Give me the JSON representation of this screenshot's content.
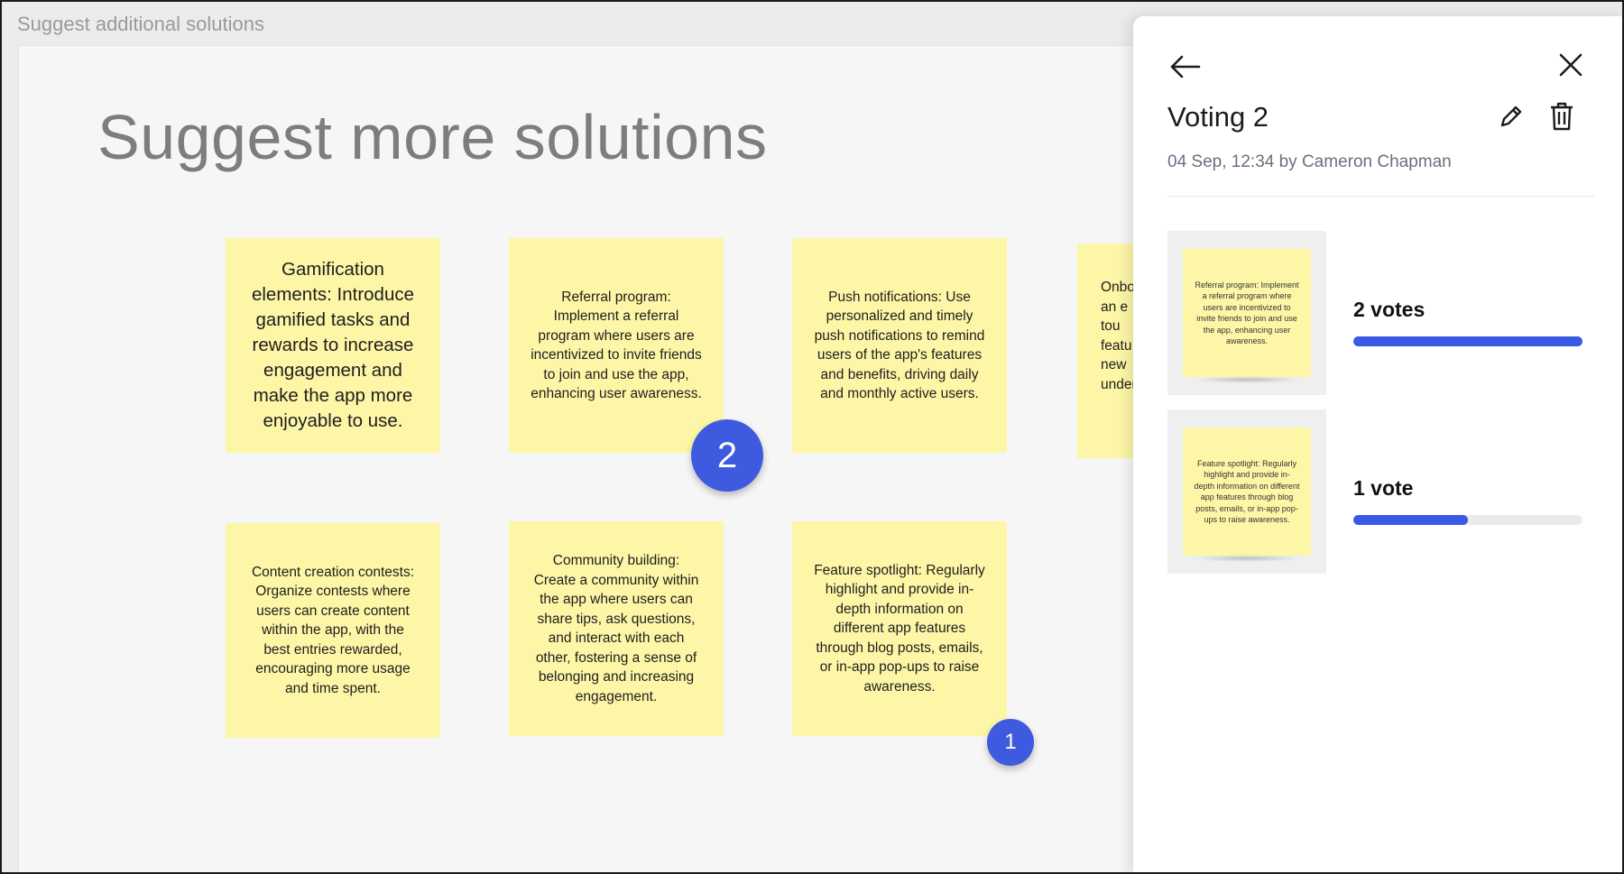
{
  "frame": {
    "title": "Suggest additional solutions"
  },
  "board": {
    "heading": "Suggest more solutions",
    "notes": [
      "Gamification elements: Introduce gamified tasks and rewards to increase engagement and make the app more enjoyable to use.",
      "Referral program: Implement a referral program where users are incentivized to invite friends to join and use the app, enhancing user awareness.",
      "Push notifications: Use personalized and timely push notifications to remind users of the app's features and benefits, driving daily and monthly active users.",
      "Onbo\nan e\ntou\nfeatu\nnew\nunder",
      "Content creation contests: Organize contests where users can create content within the app, with the best entries rewarded, encouraging more usage and time spent.",
      "Community building: Create a community within the app where users can share tips, ask questions, and interact with each other, fostering a sense of belonging and increasing engagement.",
      "Feature spotlight: Regularly highlight and provide in-depth information on different app features through blog posts, emails, or in-app pop-ups to raise awareness."
    ],
    "vote_badges": [
      "2",
      "1"
    ]
  },
  "panel": {
    "title": "Voting 2",
    "meta": "04 Sep, 12:34 by Cameron Chapman",
    "icons": {
      "back": "arrow-left-icon",
      "close": "close-icon",
      "edit": "pencil-icon",
      "delete": "trash-icon"
    },
    "results": [
      {
        "note": "Referral program: Implement a referral program where users are incentivized to invite friends to join and use the app, enhancing user awareness.",
        "label": "2 votes",
        "fill": 1.0
      },
      {
        "note": "Feature spotlight: Regularly highlight and provide in-depth information on different app features through blog posts, emails, or in-app pop-ups to raise awareness.",
        "label": "1 vote",
        "fill": 0.5
      }
    ]
  },
  "colors": {
    "accent": "#3a5ae6",
    "sticky": "#fdf6a7"
  }
}
